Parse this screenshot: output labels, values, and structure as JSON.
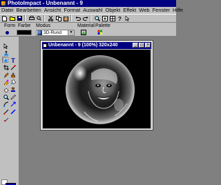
{
  "app": {
    "title": "PhotoImpact - Unbenannt - 9"
  },
  "menu": [
    "Datei",
    "Bearbeiten",
    "Ansicht",
    "Format",
    "Auswahl",
    "Objekt",
    "Effekt",
    "Web",
    "Fenster",
    "Hilfe"
  ],
  "attribute_bar": {
    "labels": {
      "form": "Form",
      "farbe": "Farbe",
      "modus": "Modus",
      "material": "Material",
      "palette": "Palette"
    },
    "mode_value": "3D-Rund",
    "color": "#000000"
  },
  "document": {
    "title": "Unbenannt - 9 (100%) 320x240"
  },
  "colors": {
    "title_bar": "#000080",
    "chrome": "#c0c0c0",
    "workspace": "#808080",
    "foreground_color": "#0000a0",
    "background_color": "#ffffff"
  },
  "icons": {
    "toolbar": [
      "new-icon",
      "open-icon",
      "save-icon",
      "print-icon",
      "preview-icon",
      "cut-icon",
      "copy-icon",
      "paste-icon",
      "undo-icon",
      "redo-icon",
      "zoom-icon",
      "help-icon"
    ],
    "tools": [
      "pick-tool-icon",
      "transform-tool-icon",
      "selection-tool-icon",
      "text-tool-icon",
      "crop-tool-icon",
      "lasso-tool-icon",
      "paint-tool-icon",
      "clone-tool-icon",
      "retouch-tool-icon",
      "fill-tool-icon",
      "eraser-tool-icon",
      "stamp-tool-icon",
      "zoom-tool-icon",
      "eyedropper-tool-icon",
      "path-tool-icon",
      "shape-tool-icon"
    ]
  }
}
